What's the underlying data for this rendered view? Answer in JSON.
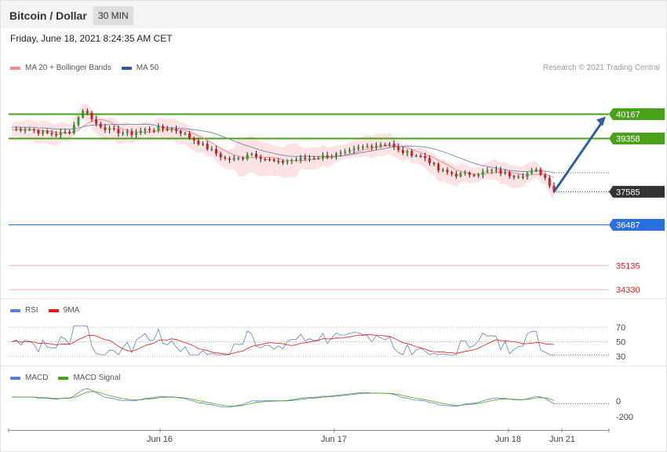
{
  "header": {
    "title": "Bitcoin / Dollar",
    "timeframe": "30 MIN"
  },
  "date_text": "Friday, June 18, 2021 8:24:35 AM CET",
  "credit": "Research © 2021 Trading Central",
  "price_legend": [
    {
      "label": "MA 20 + Bollinger Bands",
      "color": "#f28b8b"
    },
    {
      "label": "MA 50",
      "color": "#2c5a9c"
    }
  ],
  "levels": [
    {
      "value": "40167",
      "type": "resistance",
      "color": "#4aa21a"
    },
    {
      "value": "39358",
      "type": "resistance",
      "color": "#4aa21a"
    },
    {
      "value": "37585",
      "type": "current",
      "color": "#333333"
    },
    {
      "value": "36487",
      "type": "support",
      "color": "#2a6fe0"
    },
    {
      "value": "35135",
      "type": "support-weak",
      "color": "#e02020"
    },
    {
      "value": "34330",
      "type": "support-weak",
      "color": "#e02020"
    }
  ],
  "rsi_panel": {
    "legend": [
      {
        "label": "RSI",
        "color": "#5b7fd6"
      },
      {
        "label": "9MA",
        "color": "#e01818"
      }
    ],
    "ticks": [
      "70",
      "50",
      "30"
    ]
  },
  "macd_panel": {
    "legend": [
      {
        "label": "MACD",
        "color": "#5b7fd6"
      },
      {
        "label": "MACD Signal",
        "color": "#4aa21a"
      }
    ],
    "ticks": [
      "0",
      "-200"
    ]
  },
  "x_axis": {
    "labels": [
      "Jun 16",
      "Jun 17",
      "Jun 18",
      "Jun 21"
    ]
  },
  "chart_data": {
    "type": "candlestick",
    "instrument": "Bitcoin / Dollar",
    "interval": "30 MIN",
    "y_axis_levels": [
      40167,
      39358,
      37585,
      36487,
      35135,
      34330
    ],
    "last_price": 37585,
    "price_path": [
      [
        0,
        39650
      ],
      [
        10,
        39700
      ],
      [
        20,
        39550
      ],
      [
        30,
        39500
      ],
      [
        40,
        39600
      ],
      [
        45,
        40100
      ],
      [
        50,
        40350
      ],
      [
        55,
        39900
      ],
      [
        65,
        39650
      ],
      [
        80,
        39500
      ],
      [
        90,
        39650
      ],
      [
        100,
        39700
      ],
      [
        110,
        39650
      ],
      [
        115,
        39550
      ],
      [
        125,
        39250
      ],
      [
        135,
        38950
      ],
      [
        145,
        38650
      ],
      [
        155,
        38700
      ],
      [
        160,
        38900
      ],
      [
        170,
        38700
      ],
      [
        180,
        38550
      ],
      [
        190,
        38650
      ],
      [
        200,
        38700
      ],
      [
        215,
        38800
      ],
      [
        225,
        38850
      ],
      [
        235,
        39050
      ],
      [
        245,
        39150
      ],
      [
        255,
        39200
      ],
      [
        260,
        38950
      ],
      [
        270,
        38850
      ],
      [
        280,
        38700
      ],
      [
        288,
        38300
      ],
      [
        300,
        38150
      ],
      [
        315,
        38200
      ],
      [
        325,
        38300
      ],
      [
        335,
        38150
      ],
      [
        345,
        38150
      ],
      [
        355,
        38300
      ],
      [
        360,
        38050
      ],
      [
        366,
        37650
      ]
    ],
    "rsi_ticks": [
      70,
      50,
      30
    ],
    "macd_ticks": [
      0,
      -200
    ],
    "x_labels": [
      "Jun 16",
      "Jun 17",
      "Jun 18",
      "Jun 21"
    ],
    "projection": {
      "from": 37585,
      "to": 40167
    }
  }
}
